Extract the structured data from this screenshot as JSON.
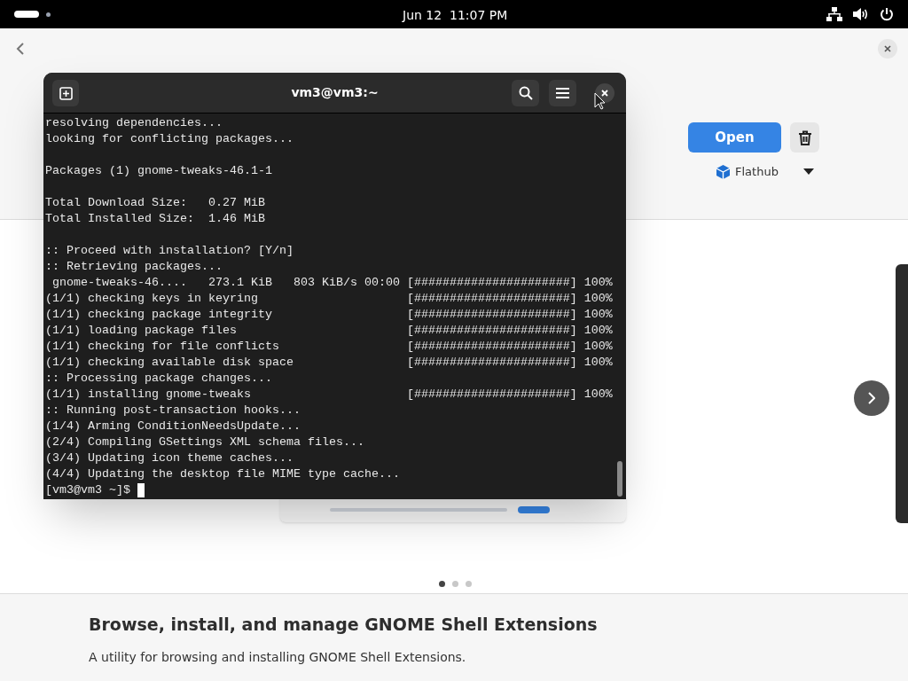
{
  "top_bar": {
    "clock": "Jun 12  11:07 PM"
  },
  "app": {
    "open_button": "Open",
    "source": "Flathub",
    "carousel_dots": [
      {
        "selected": true
      },
      {
        "selected": false
      },
      {
        "selected": false
      }
    ],
    "title": "Browse, install, and manage GNOME Shell Extensions",
    "summary": "A utility for browsing and installing GNOME Shell Extensions."
  },
  "terminal": {
    "title": "vm3@vm3:~",
    "blocks": [
      [
        "resolving dependencies...",
        "looking for conflicting packages..."
      ],
      [
        "Packages (1) gnome-tweaks-46.1-1"
      ],
      [
        "Total Download Size:   0.27 MiB",
        "Total Installed Size:  1.46 MiB"
      ],
      [
        ":: Proceed with installation? [Y/n]",
        ":: Retrieving packages...",
        " gnome-tweaks-46....   273.1 KiB   803 KiB/s 00:00 [######################] 100%",
        "(1/1) checking keys in keyring                     [######################] 100%",
        "(1/1) checking package integrity                   [######################] 100%",
        "(1/1) loading package files                        [######################] 100%",
        "(1/1) checking for file conflicts                  [######################] 100%",
        "(1/1) checking available disk space                [######################] 100%",
        ":: Processing package changes...",
        "(1/1) installing gnome-tweaks                      [######################] 100%",
        ":: Running post-transaction hooks...",
        "(1/4) Arming ConditionNeedsUpdate...",
        "(2/4) Compiling GSettings XML schema files...",
        "(3/4) Updating icon theme caches...",
        "(4/4) Updating the desktop file MIME type cache..."
      ]
    ],
    "prompt": "[vm3@vm3 ~]$ "
  }
}
